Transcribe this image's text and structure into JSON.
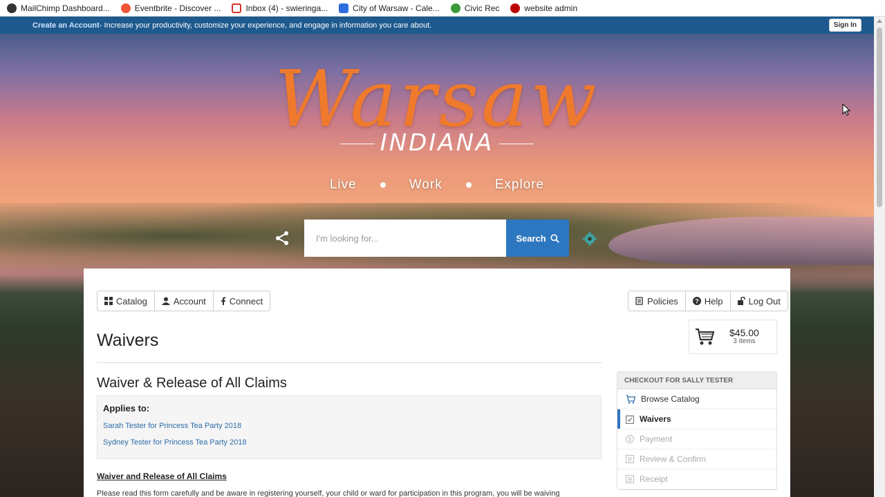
{
  "bookmarks": [
    {
      "label": "MailChimp Dashboard...",
      "icon": "mailchimp-icon",
      "color": "#333"
    },
    {
      "label": "Eventbrite - Discover ...",
      "icon": "eventbrite-icon",
      "color": "#f05537"
    },
    {
      "label": "Inbox (4) - swieringa...",
      "icon": "gmail-icon",
      "color": "#d93025"
    },
    {
      "label": "City of Warsaw - Cale...",
      "icon": "calendar-icon",
      "color": "#2d6cdf"
    },
    {
      "label": "Civic Rec",
      "icon": "civicrec-icon",
      "color": "#3a9a3a"
    },
    {
      "label": "website admin",
      "icon": "admin-icon",
      "color": "#b00"
    }
  ],
  "account_strip": {
    "create_label": "Create an Account",
    "message": " - Increase your productivity, customize your experience, and engage in information you care about.",
    "sign_in_label": "Sign In"
  },
  "hero": {
    "logo_script": "Warsaw",
    "logo_sub": "INDIANA",
    "tagline": [
      "Live",
      "Work",
      "Explore"
    ],
    "search_placeholder": "I'm looking for...",
    "search_label": "Search"
  },
  "nav_left": [
    {
      "label": "Catalog",
      "icon": "grid-icon"
    },
    {
      "label": "Account",
      "icon": "user-icon"
    },
    {
      "label": "Connect",
      "icon": "facebook-icon"
    }
  ],
  "nav_right": [
    {
      "label": "Policies",
      "icon": "policies-icon"
    },
    {
      "label": "Help",
      "icon": "help-icon"
    },
    {
      "label": "Log Out",
      "icon": "unlock-icon"
    }
  ],
  "cart": {
    "amount": "$45.00",
    "items": "3 items"
  },
  "page": {
    "title": "Waivers",
    "section_title": "Waiver & Release of All Claims",
    "applies_label": "Applies to:",
    "applies_items": [
      "Sarah Tester for Princess Tea Party 2018",
      "Sydney Tester for Princess Tea Party 2018"
    ],
    "waiver_heading": "Waiver and Release of All Claims",
    "waiver_text": "Please read this form carefully and be aware in registering yourself, your child or ward for participation in this program, you will be waiving"
  },
  "checkout": {
    "header": "CHECKOUT FOR SALLY TESTER",
    "steps": [
      {
        "label": "Browse Catalog",
        "icon": "cart-icon",
        "state": "enabled"
      },
      {
        "label": "Waivers",
        "icon": "waiver-icon",
        "state": "active"
      },
      {
        "label": "Payment",
        "icon": "payment-icon",
        "state": "disabled"
      },
      {
        "label": "Review & Confirm",
        "icon": "review-icon",
        "state": "disabled"
      },
      {
        "label": "Receipt",
        "icon": "receipt-icon",
        "state": "disabled"
      }
    ]
  },
  "colors": {
    "accent": "#2d76c0",
    "strip": "#1e5a8e",
    "logo": "#f07a2c"
  }
}
